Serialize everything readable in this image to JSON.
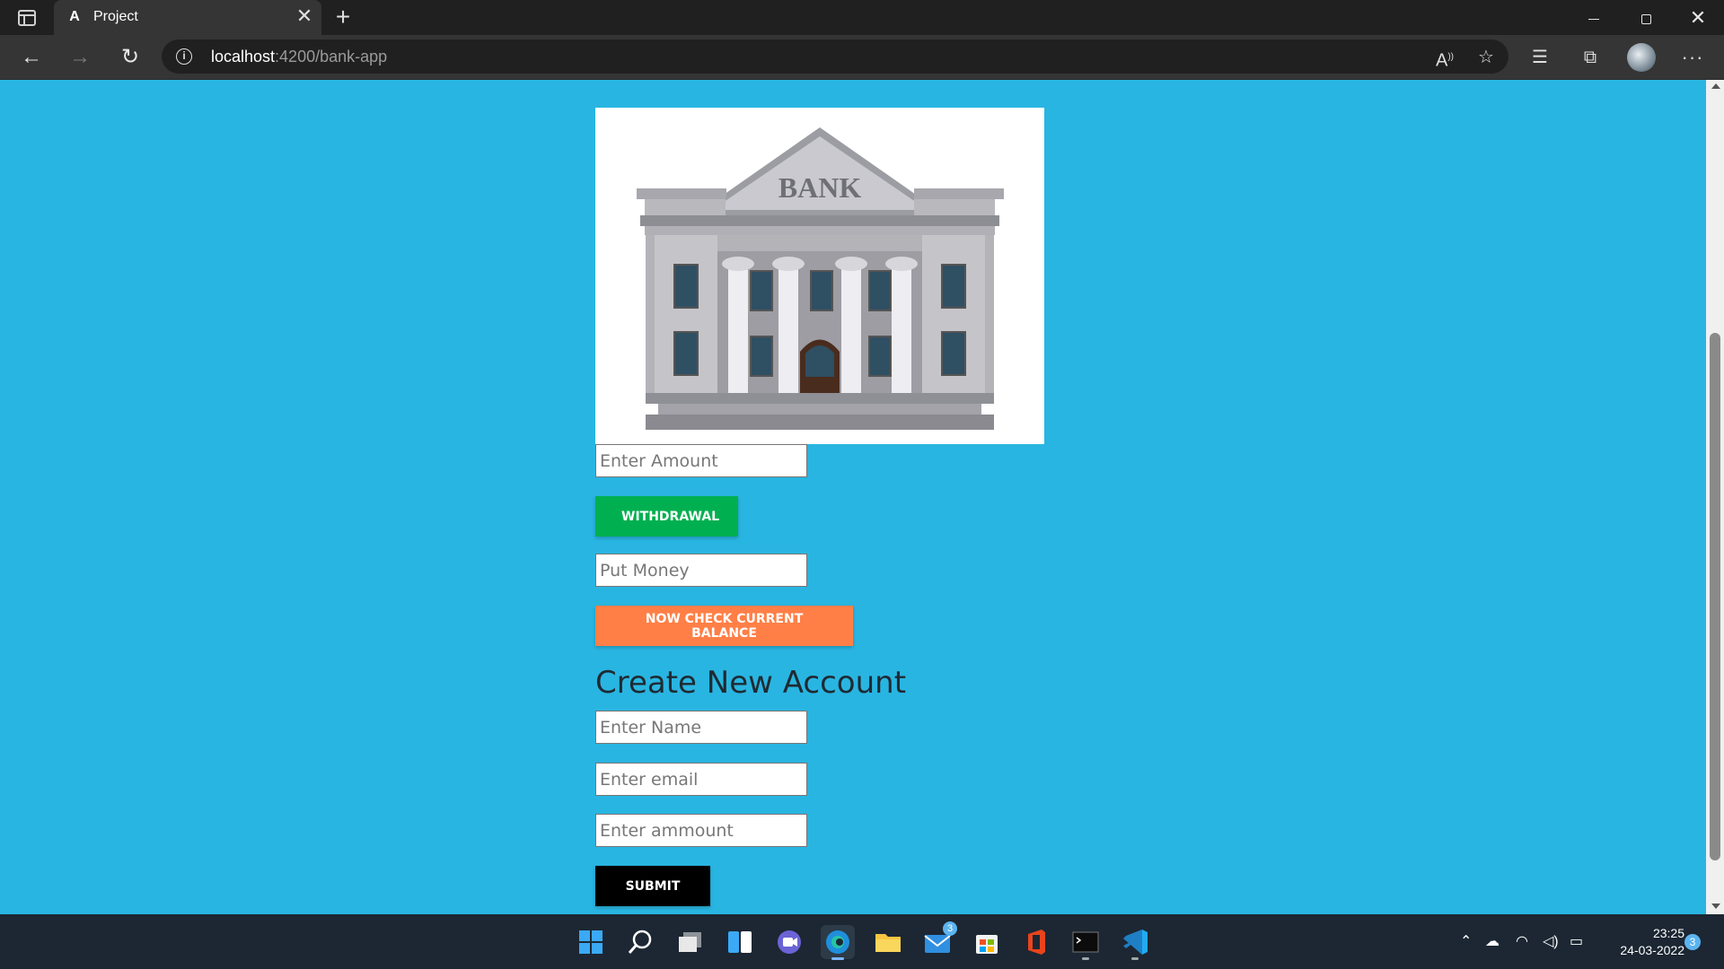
{
  "browser": {
    "tab_title": "Project",
    "tab_favicon": "A",
    "url_host": "localhost",
    "url_rest": ":4200/bank-app",
    "tab_close": "✕",
    "new_tab": "+",
    "more": "···"
  },
  "page": {
    "bank_sign": "BANK",
    "amount_placeholder": "Enter Amount",
    "withdraw_label": "WITHDRAWAL",
    "put_money_placeholder": "Put Money",
    "check_balance_label": "NOW CHECK CURRENT BALANCE",
    "create_heading": "Create New Account",
    "name_placeholder": "Enter Name",
    "email_placeholder": "Enter email",
    "ammount_placeholder": "Enter ammount",
    "submit_label": "SUBMIT"
  },
  "taskbar": {
    "time": "23:25",
    "date": "24-03-2022",
    "mail_badge": "3",
    "notification_count": "3"
  },
  "colors": {
    "page_bg": "#29b5e1",
    "withdraw": "#00b050",
    "check_balance": "#ff7f47",
    "submit": "#000000"
  }
}
